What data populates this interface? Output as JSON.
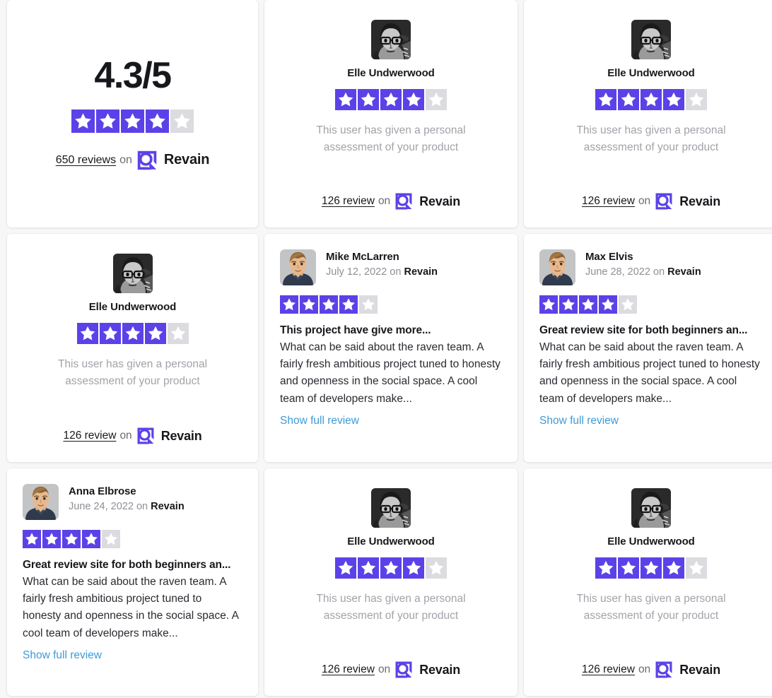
{
  "brand": {
    "name": "Revain",
    "accent": "#5b42e8",
    "link_color": "#3e9ad8",
    "star_off_color": "#dcdce0",
    "logo_icon": "revain-logo-icon"
  },
  "summary": {
    "score": "4.3/5",
    "rating": 4,
    "max_rating": 5,
    "reviews_count": "650 reviews",
    "on_label": "on",
    "brand_label": "Revain"
  },
  "common": {
    "profile_note": "This user has given a personal assessment of your product",
    "on_label": "on",
    "brand_label": "Revain",
    "show_full_review": "Show full review",
    "review_body": "What can be said about the raven team. A fairly fresh ambitious project tuned to honesty and openness in the social space. A cool team of developers make..."
  },
  "cards": [
    {
      "type": "summary",
      "score": "4.3/5",
      "rating": 4,
      "reviews_count": "650 reviews",
      "on_label": "on",
      "brand_label": "Revain"
    },
    {
      "type": "profile",
      "name": "Elle Undwerwood",
      "avatar": "avatar-bw-glasses",
      "rating": 4,
      "note": "This user has given a personal assessment of your product",
      "reviews_count": "126 review",
      "on_label": "on",
      "brand_label": "Revain"
    },
    {
      "type": "profile",
      "name": "Elle Undwerwood",
      "avatar": "avatar-bw-glasses",
      "rating": 4,
      "note": "This user has given a personal assessment of your product",
      "reviews_count": "126 review",
      "on_label": "on",
      "brand_label": "Revain"
    },
    {
      "type": "profile",
      "name": "Elle Undwerwood",
      "avatar": "avatar-bw-glasses",
      "rating": 4,
      "note": "This user has given a personal assessment of your product",
      "reviews_count": "126 review",
      "on_label": "on",
      "brand_label": "Revain"
    },
    {
      "type": "review",
      "name": "Mike McLarren",
      "avatar": "avatar-color-man",
      "date": "July 12, 2022",
      "on_label": "on",
      "brand_label": "Revain",
      "rating": 4,
      "title": "This project have give more...",
      "body": "What can be said about the raven team. A fairly fresh ambitious project tuned to honesty and openness in the social space. A cool team of developers make...",
      "link": "Show full review"
    },
    {
      "type": "review",
      "name": "Max Elvis",
      "avatar": "avatar-color-man",
      "date": "June 28, 2022",
      "on_label": "on",
      "brand_label": "Revain",
      "rating": 4,
      "title": "Great review site for both beginners an...",
      "body": "What can be said about the raven team. A fairly fresh ambitious project tuned to honesty and openness in the social space. A cool team of developers make...",
      "link": "Show full review"
    },
    {
      "type": "review",
      "name": "Anna Elbrose",
      "avatar": "avatar-color-man",
      "date": "June 24, 2022",
      "on_label": "on",
      "brand_label": "Revain",
      "rating": 4,
      "title": "Great review site for both beginners an...",
      "body": "What can be said about the raven team. A fairly fresh ambitious project tuned to honesty and openness in the social space. A cool team of developers make...",
      "link": "Show full review"
    },
    {
      "type": "profile",
      "name": "Elle Undwerwood",
      "avatar": "avatar-bw-glasses",
      "rating": 4,
      "note": "This user has given a personal assessment of your product",
      "reviews_count": "126 review",
      "on_label": "on",
      "brand_label": "Revain"
    },
    {
      "type": "profile",
      "name": "Elle Undwerwood",
      "avatar": "avatar-bw-glasses",
      "rating": 4,
      "note": "This user has given a personal assessment of your product",
      "reviews_count": "126 review",
      "on_label": "on",
      "brand_label": "Revain"
    }
  ]
}
